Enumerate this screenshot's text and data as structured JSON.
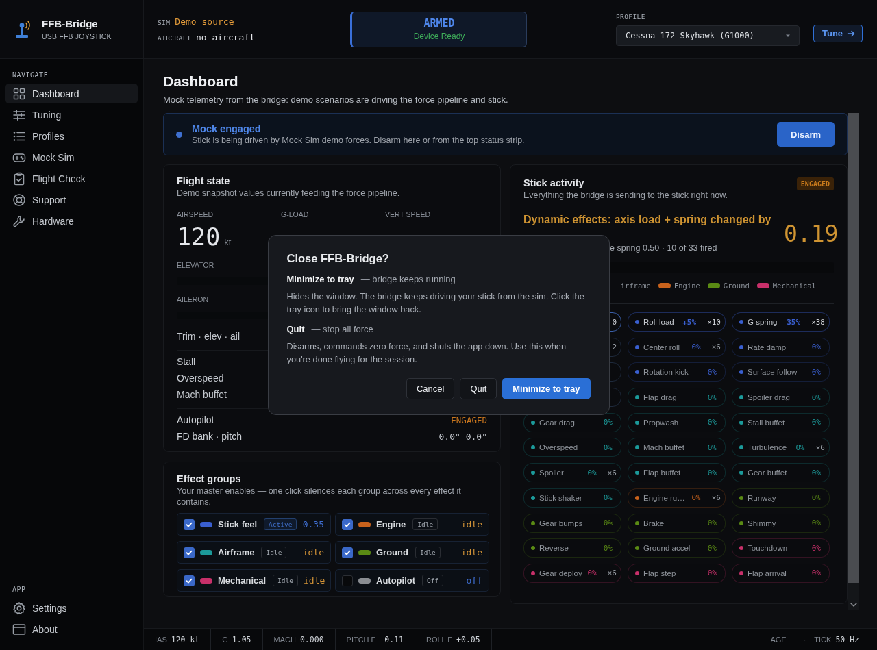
{
  "app": {
    "name": "FFB-Bridge",
    "subtitle": "USB FFB JOYSTICK"
  },
  "header": {
    "sim_label": "SIM",
    "sim_value": "Demo source",
    "aircraft_label": "AIRCRAFT",
    "aircraft_value": "no aircraft",
    "status_title": "ARMED",
    "status_detail": "Device Ready",
    "profile_label": "PROFILE",
    "profile": "Cessna 172 Skyhawk (G1000)",
    "tune_button": "Tune"
  },
  "sidebar": {
    "sections": [
      {
        "label": "NAVIGATE",
        "items": [
          {
            "label": "Dashboard",
            "selected": true
          },
          {
            "label": "Tuning",
            "selected": false
          },
          {
            "label": "Profiles",
            "selected": false
          },
          {
            "label": "Mock Sim",
            "selected": false
          },
          {
            "label": "Flight Check",
            "selected": false
          },
          {
            "label": "Support",
            "selected": false
          },
          {
            "label": "Hardware",
            "selected": false
          }
        ]
      },
      {
        "label": "APP",
        "items": [
          {
            "label": "Settings",
            "selected": false
          },
          {
            "label": "About",
            "selected": false
          }
        ]
      }
    ]
  },
  "page": {
    "title": "Dashboard",
    "subtitle": "Mock telemetry from the bridge: demo scenarios are driving the force pipeline and stick."
  },
  "banner": {
    "title": "Mock engaged",
    "text": "Stick is being driven by Mock Sim demo forces. Disarm here or from the top status strip.",
    "button": "Disarm"
  },
  "flight_state": {
    "title": "Flight state",
    "subtitle": "Demo snapshot values currently feeding the force pipeline.",
    "stats": [
      {
        "label": "AIRSPEED",
        "value": "120",
        "unit": "kt"
      },
      {
        "label": "G-LOAD"
      },
      {
        "label": "VERT SPEED"
      }
    ],
    "axes": [
      {
        "label": "ELEVATOR"
      },
      {
        "label": "AILERON"
      }
    ],
    "row_groups": [
      {
        "rows": [
          {
            "kind": "plain",
            "label": "Trim · elev · ail"
          }
        ]
      },
      {
        "rows": [
          {
            "kind": "plain",
            "label": "Stall"
          },
          {
            "kind": "plain",
            "label": "Overspeed"
          },
          {
            "kind": "plain",
            "label": "Mach buffet"
          }
        ]
      },
      {
        "rows": [
          {
            "kind": "status",
            "label": "Autopilot",
            "value": "ENGAGED"
          },
          {
            "kind": "reading",
            "label": "FD bank · pitch",
            "value": "0.0° 0.0°"
          }
        ]
      }
    ]
  },
  "effect_groups": {
    "title": "Effect groups",
    "subtitle": "Your master enables — one click silences each group across every effect it contains.",
    "groups": [
      {
        "name": "Stick feel",
        "color": "#3a5fd0",
        "checked": true,
        "active": true,
        "state": "Active",
        "value": "0.35"
      },
      {
        "name": "Engine",
        "color": "#c8621c",
        "checked": true,
        "active": false,
        "state": "Idle",
        "value": "idle"
      },
      {
        "name": "Airframe",
        "color": "#1c9a9a",
        "checked": true,
        "active": false,
        "state": "Idle",
        "value": "idle"
      },
      {
        "name": "Ground",
        "color": "#5a8a14",
        "checked": true,
        "active": false,
        "state": "Idle",
        "value": "idle"
      },
      {
        "name": "Mechanical",
        "color": "#c8306a",
        "checked": true,
        "active": false,
        "state": "Idle",
        "value": "idle"
      },
      {
        "name": "Autopilot",
        "color": "#8a8d92",
        "checked": false,
        "active": false,
        "state": "Off",
        "value": "off"
      }
    ]
  },
  "stick_activity": {
    "title": "Stick activity",
    "subtitle": "Everything the bridge is sending to the stick right now.",
    "badge": "ENGAGED",
    "headline": "Dynamic effects: axis load + spring changed by",
    "value": "0.19",
    "detail": "e spring 0.50 · 10 of 33 fired",
    "legend": [
      {
        "label": "irframe"
      },
      {
        "label": "Engine",
        "color": "#c8621c"
      },
      {
        "label": "Ground",
        "color": "#5a8a14"
      },
      {
        "label": "Mechanical",
        "color": "#c8306a"
      }
    ],
    "chips": [
      {
        "count": "0",
        "active": true
      },
      {
        "name": "Roll load",
        "pct": "+5%",
        "count": "×10",
        "color": "#3a5fd0",
        "active": true
      },
      {
        "name": "G spring",
        "pct": "35%",
        "count": "×38",
        "color": "#3a5fd0",
        "active": true
      },
      {
        "count": "2",
        "active": false
      },
      {
        "name": "Center roll",
        "pct": "0%",
        "count": "×6",
        "color": "#3a5fd0",
        "active": false
      },
      {
        "name": "Rate damp",
        "pct": "0%",
        "color": "#3a5fd0",
        "active": false
      },
      {
        "active": false
      },
      {
        "name": "Rotation kick",
        "pct": "0%",
        "color": "#3a5fd0",
        "active": false
      },
      {
        "name": "Surface follow",
        "pct": "0%",
        "color": "#3a5fd0",
        "active": false
      },
      {
        "active": false
      },
      {
        "name": "Flap drag",
        "pct": "0%",
        "color": "#1c9a9a",
        "active": false
      },
      {
        "name": "Spoiler drag",
        "pct": "0%",
        "color": "#1c9a9a",
        "active": false
      },
      {
        "name": "Gear drag",
        "pct": "0%",
        "color": "#1c9a9a",
        "active": false
      },
      {
        "name": "Propwash",
        "pct": "0%",
        "color": "#1c9a9a",
        "active": false
      },
      {
        "name": "Stall buffet",
        "pct": "0%",
        "color": "#1c9a9a",
        "active": false
      },
      {
        "name": "Overspeed",
        "pct": "0%",
        "color": "#1c9a9a",
        "active": false
      },
      {
        "name": "Mach buffet",
        "pct": "0%",
        "color": "#1c9a9a",
        "active": false
      },
      {
        "name": "Turbulence",
        "pct": "0%",
        "count": "×6",
        "color": "#1c9a9a",
        "active": false
      },
      {
        "name": "Spoiler",
        "pct": "0%",
        "count": "×6",
        "color": "#1c9a9a",
        "active": false
      },
      {
        "name": "Flap buffet",
        "pct": "0%",
        "color": "#1c9a9a",
        "active": false
      },
      {
        "name": "Gear buffet",
        "pct": "0%",
        "color": "#1c9a9a",
        "active": false
      },
      {
        "name": "Stick shaker",
        "pct": "0%",
        "color": "#1c9a9a",
        "active": false
      },
      {
        "name": "Engine ru…",
        "pct": "0%",
        "count": "×6",
        "color": "#c8621c",
        "active": false
      },
      {
        "name": "Runway",
        "pct": "0%",
        "color": "#5a8a14",
        "active": false
      },
      {
        "name": "Gear bumps",
        "pct": "0%",
        "color": "#5a8a14",
        "active": false
      },
      {
        "name": "Brake",
        "pct": "0%",
        "color": "#5a8a14",
        "active": false
      },
      {
        "name": "Shimmy",
        "pct": "0%",
        "color": "#5a8a14",
        "active": false
      },
      {
        "name": "Reverse",
        "pct": "0%",
        "color": "#5a8a14",
        "active": false
      },
      {
        "name": "Ground accel",
        "pct": "0%",
        "color": "#5a8a14",
        "active": false
      },
      {
        "name": "Touchdown",
        "pct": "0%",
        "color": "#c8306a",
        "active": false
      },
      {
        "name": "Gear deploy",
        "pct": "0%",
        "count": "×6",
        "color": "#c8306a",
        "active": false
      },
      {
        "name": "Flap step",
        "pct": "0%",
        "color": "#c8306a",
        "active": false
      },
      {
        "name": "Flap arrival",
        "pct": "0%",
        "color": "#c8306a",
        "active": false
      }
    ]
  },
  "status_bar": {
    "items": [
      {
        "label": "IAS",
        "value": "120 kt"
      },
      {
        "label": "G",
        "value": "1.05"
      },
      {
        "label": "MACH",
        "value": "0.000"
      },
      {
        "label": "PITCH F",
        "value": "-0.11"
      },
      {
        "label": "ROLL F",
        "value": "+0.05"
      }
    ],
    "right": [
      {
        "label": "AGE",
        "value": "—"
      },
      {
        "label": "TICK",
        "value": "50 Hz"
      }
    ],
    "separator": "·"
  },
  "dialog": {
    "title": "Close FFB-Bridge?",
    "options": [
      {
        "name": "Minimize to tray",
        "summary": "— bridge keeps running",
        "text": "Hides the window. The bridge keeps driving your stick from the sim. Click the tray icon to bring the window back."
      },
      {
        "name": "Quit",
        "summary": "— stop all force",
        "text": "Disarms, commands zero force, and shuts the app down. Use this when you're done flying for the session."
      }
    ],
    "buttons": [
      {
        "label": "Cancel",
        "primary": false
      },
      {
        "label": "Quit",
        "primary": false
      },
      {
        "label": "Minimize to tray",
        "primary": true
      }
    ]
  }
}
